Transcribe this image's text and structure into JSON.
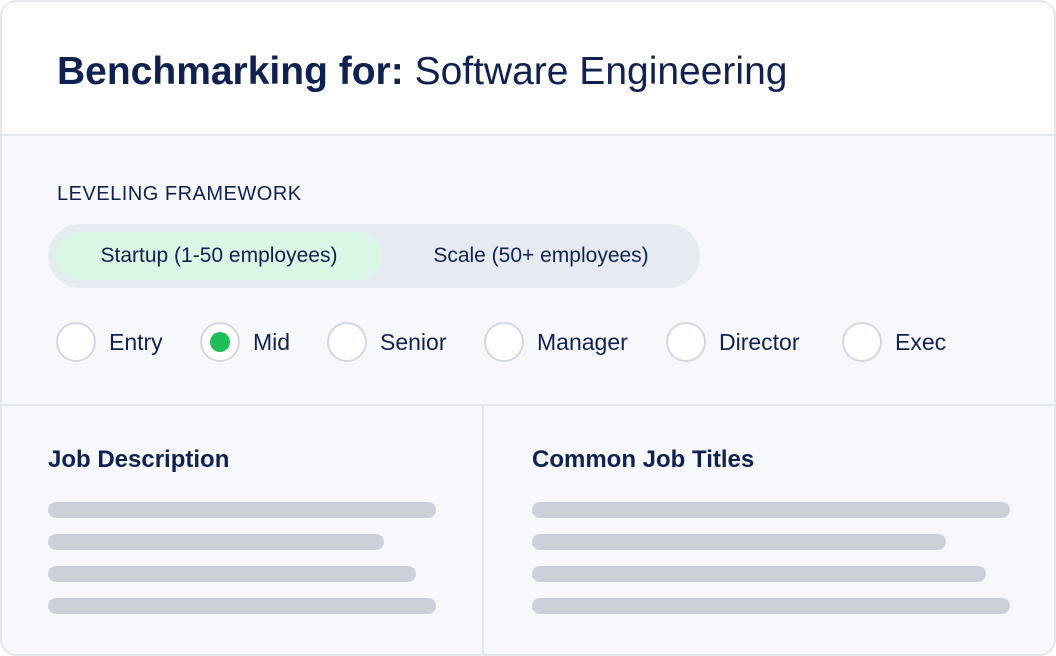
{
  "header": {
    "title_bold": "Benchmarking for:",
    "title_regular": "Software Engineering"
  },
  "framework": {
    "label": "LEVELING FRAMEWORK",
    "options": [
      {
        "label": "Startup (1-50 employees)",
        "selected": true
      },
      {
        "label": "Scale (50+ employees)",
        "selected": false
      }
    ]
  },
  "levels": [
    {
      "label": "Entry",
      "checked": false
    },
    {
      "label": "Mid",
      "checked": true
    },
    {
      "label": "Senior",
      "checked": false
    },
    {
      "label": "Manager",
      "checked": false
    },
    {
      "label": "Director",
      "checked": false
    },
    {
      "label": "Exec",
      "checked": false
    }
  ],
  "panels": {
    "left_title": "Job Description",
    "right_title": "Common Job Titles"
  },
  "colors": {
    "accent_green": "#1fbf57",
    "selected_segment_bg": "#d9f7e4",
    "text_navy": "#0f2150",
    "skeleton": "#cbd0db"
  }
}
